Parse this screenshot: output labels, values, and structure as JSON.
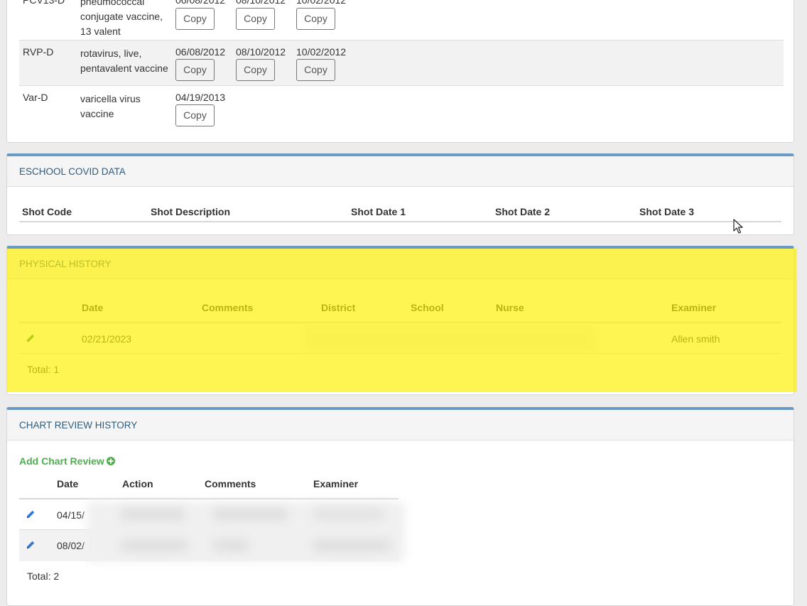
{
  "immunizations": {
    "copy_label": "Copy",
    "rows": [
      {
        "code": "PCV13-D",
        "description": "pneumococcal conjugate vaccine, 13 valent",
        "dates": [
          "06/08/2012",
          "08/10/2012",
          "10/02/2012"
        ]
      },
      {
        "code": "RVP-D",
        "description": "rotavirus, live, pentavalent vaccine",
        "dates": [
          "06/08/2012",
          "08/10/2012",
          "10/02/2012"
        ]
      },
      {
        "code": "Var-D",
        "description": "varicella virus vaccine",
        "dates": [
          "04/19/2013"
        ]
      }
    ]
  },
  "eschool_covid": {
    "title": "ESCHOOL COVID DATA",
    "columns": [
      "Shot Code",
      "Shot Description",
      "Shot Date 1",
      "Shot Date 2",
      "Shot Date 3"
    ]
  },
  "physical_history": {
    "title": "PHYSICAL HISTORY",
    "columns": [
      "Date",
      "Comments",
      "District",
      "School",
      "Nurse",
      "Examiner"
    ],
    "rows": [
      {
        "date": "02/21/2023",
        "comments": "",
        "examiner": "Allen smith"
      }
    ],
    "total": "Total: 1",
    "highlight_color": "#fff200"
  },
  "chart_review_history": {
    "title": "CHART REVIEW HISTORY",
    "add_label": "Add Chart Review",
    "columns": [
      "Date",
      "Action",
      "Comments",
      "Examiner"
    ],
    "rows": [
      {
        "date": "04/15/"
      },
      {
        "date": "08/02/"
      }
    ],
    "total": "Total: 2"
  },
  "colors": {
    "panel_accent": "#6a9ac4",
    "heading_text": "#2f5b7c",
    "edit_green": "#2e8b3a",
    "edit_blue": "#2f7ad8",
    "add_green": "#4fae4f"
  }
}
